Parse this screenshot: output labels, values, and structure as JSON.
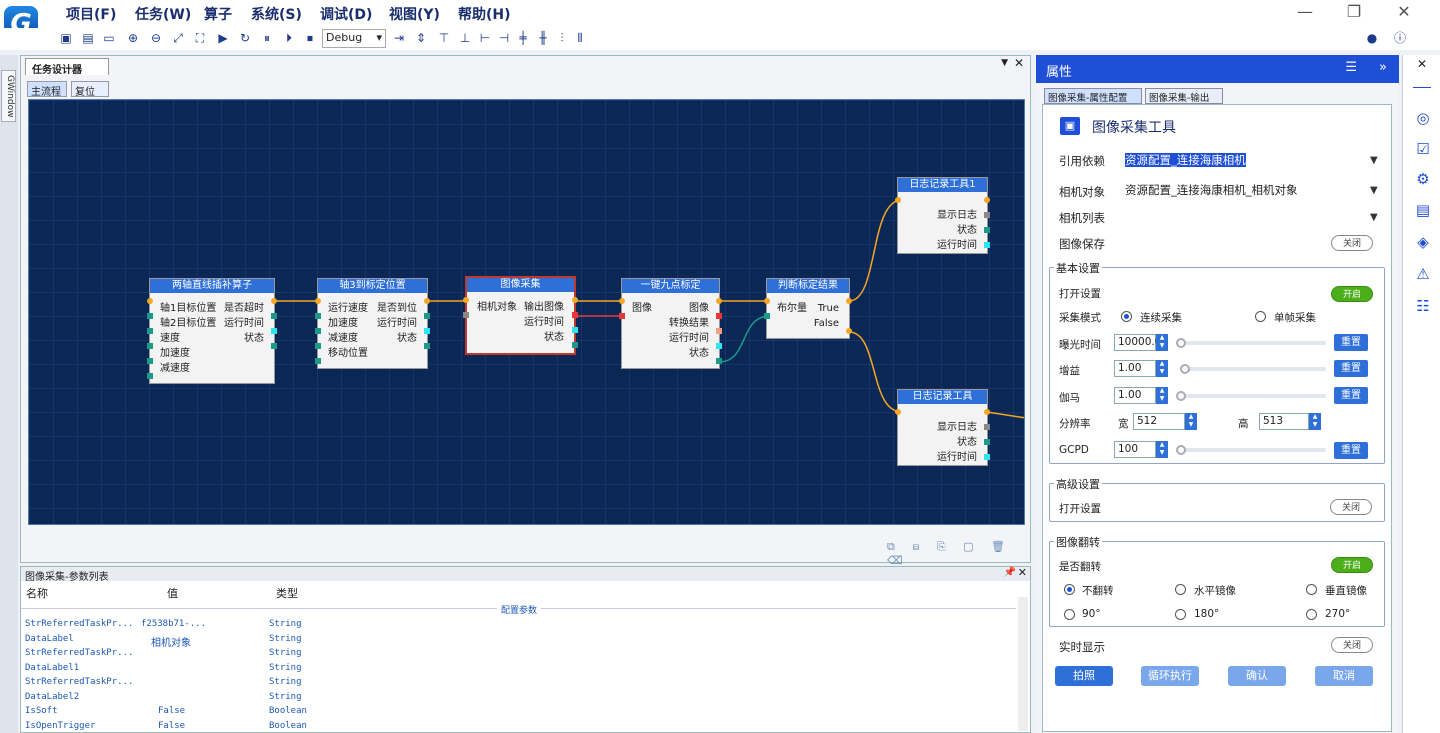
{
  "menu": {
    "items": [
      "项目(F)",
      "任务(W)",
      "算子",
      "系统(S)",
      "调试(D)",
      "视图(Y)",
      "帮助(H)"
    ],
    "logo": "G"
  },
  "toolbar": {
    "mode_select": "Debug"
  },
  "left_strip": {
    "tab": "GWindow"
  },
  "designer": {
    "tab": "任务设计器",
    "subtabs": [
      "主流程",
      "复位"
    ]
  },
  "nodes": {
    "n1": {
      "title": "两轴直线插补算子",
      "rows_left": [
        "轴1目标位置",
        "轴2目标位置",
        "速度",
        "加速度",
        "减速度"
      ],
      "rows_right": [
        "是否超时",
        "运行时间",
        "状态"
      ]
    },
    "n2": {
      "title": "轴3到标定位置",
      "rows_left": [
        "运行速度",
        "加速度",
        "减速度",
        "移动位置"
      ],
      "rows_right": [
        "是否到位",
        "运行时间",
        "状态"
      ]
    },
    "n3": {
      "title": "图像采集",
      "rows_left": [
        "相机对象"
      ],
      "rows_right": [
        "输出图像",
        "运行时间",
        "状态"
      ]
    },
    "n4": {
      "title": "一键九点标定",
      "rows_left": [
        "图像"
      ],
      "rows_right": [
        "图像",
        "转换结果",
        "运行时间",
        "状态"
      ]
    },
    "n5": {
      "title": "判断标定结果",
      "rows_left": [
        "布尔量"
      ],
      "rows_right": [
        "True",
        "False"
      ]
    },
    "n6": {
      "title": "日志记录工具1",
      "rows_right": [
        "显示日志",
        "状态",
        "运行时间"
      ]
    },
    "n7": {
      "title": "日志记录工具",
      "rows_right": [
        "显示日志",
        "状态",
        "运行时间"
      ]
    }
  },
  "params": {
    "title": "图像采集-参数列表",
    "headers": [
      "名称",
      "值",
      "类型"
    ],
    "section": "配置参数",
    "rows": [
      {
        "name": "StrReferredTaskPr...",
        "value": "f2538b71-...",
        "type": "String"
      },
      {
        "name": "DataLabel",
        "value": "相机对象",
        "type": "String"
      },
      {
        "name": "StrReferredTaskPr...",
        "value": "",
        "type": "String"
      },
      {
        "name": "DataLabel1",
        "value": "",
        "type": "String"
      },
      {
        "name": "StrReferredTaskPr...",
        "value": "",
        "type": "String"
      },
      {
        "name": "DataLabel2",
        "value": "",
        "type": "String"
      },
      {
        "name": "IsSoft",
        "value": "False",
        "type": "Boolean"
      },
      {
        "name": "IsOpenTrigger",
        "value": "False",
        "type": "Boolean"
      }
    ]
  },
  "props": {
    "header": "属性",
    "tabs": [
      "图像采集-属性配置",
      "图像采集-输出"
    ],
    "tool_title": "图像采集工具",
    "ref_label": "引用依赖",
    "ref_value": "资源配置_连接海康相机",
    "cam_label": "相机对象",
    "cam_value": "资源配置_连接海康相机_相机对象",
    "camlist_label": "相机列表",
    "save_label": "图像保存",
    "off": "关闭",
    "on": "开启",
    "basic": {
      "title": "基本设置",
      "open_label": "打开设置",
      "mode_label": "采集模式",
      "mode_cont": "连续采集",
      "mode_single": "单帧采集",
      "exposure_label": "曝光时间",
      "exposure_value": "10000.0",
      "gain_label": "增益",
      "gain_value": "1.00",
      "gamma_label": "伽马",
      "gamma_value": "1.00",
      "res_label": "分辨率",
      "width_label": "宽",
      "width_value": "512",
      "height_label": "高",
      "height_value": "513",
      "gcpd_label": "GCPD",
      "gcpd_value": "100",
      "reset": "重置"
    },
    "advanced": {
      "title": "高级设置",
      "open_label": "打开设置"
    },
    "flip": {
      "title": "图像翻转",
      "flip_label": "是否翻转",
      "opt_none": "不翻转",
      "opt_h": "水平镜像",
      "opt_v": "垂直镜像",
      "r90": "90°",
      "r180": "180°",
      "r270": "270°"
    },
    "realtime_label": "实时显示",
    "buttons": [
      "拍照",
      "循环执行",
      "确认",
      "取消"
    ]
  },
  "colors": {
    "accent": "#1e4fd6",
    "canvas": "#0b2756",
    "node_header": "#2e6fd8",
    "wire": "#f5a623",
    "toggle_on": "#4caf1a"
  }
}
